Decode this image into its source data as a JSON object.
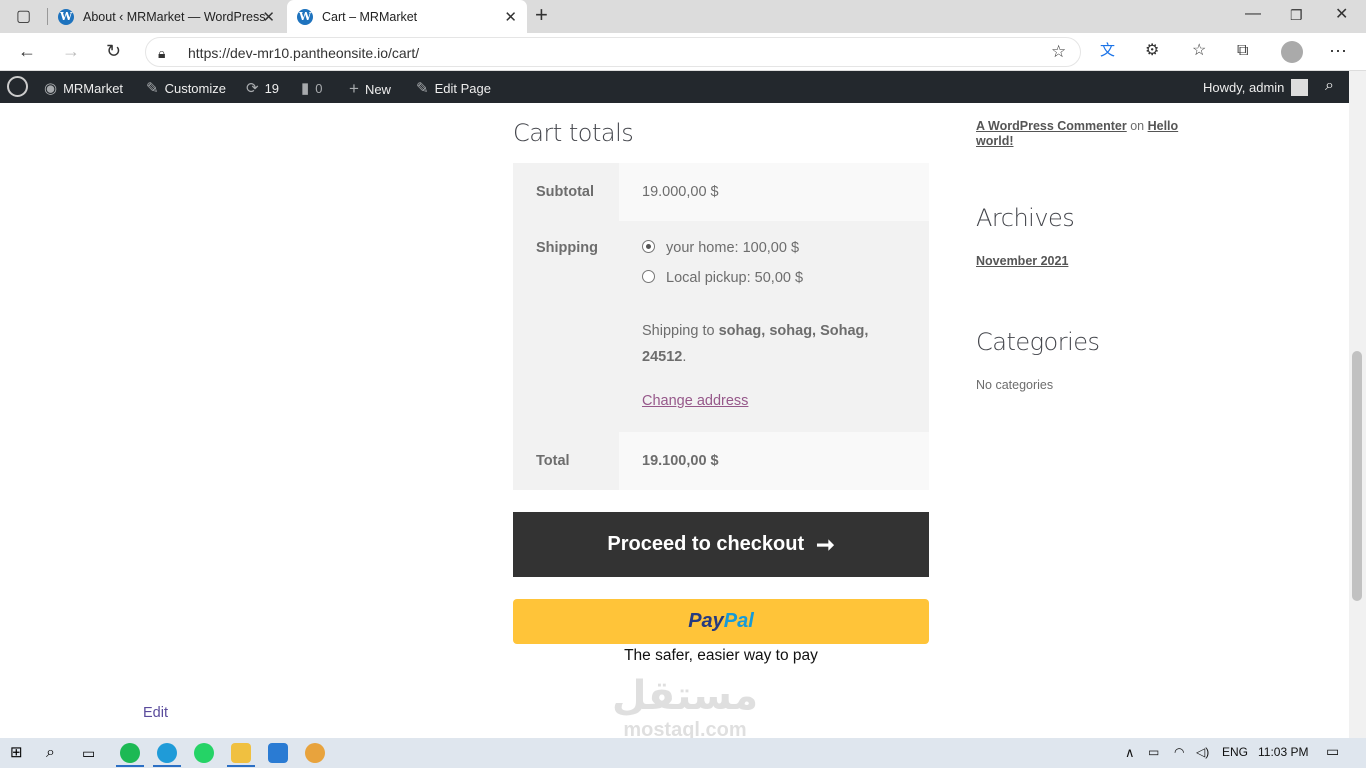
{
  "browser": {
    "tabs": [
      {
        "title": "About ‹ MRMarket — WordPress"
      },
      {
        "title": "Cart – MRMarket"
      }
    ],
    "url": "https://dev-mr10.pantheonsite.io/cart/"
  },
  "adminbar": {
    "site": "MRMarket",
    "customize": "Customize",
    "updates": "19",
    "comments": "0",
    "new": "New",
    "edit_page": "Edit Page",
    "greeting": "Howdy, admin"
  },
  "cart": {
    "title": "Cart totals",
    "subtotal_label": "Subtotal",
    "subtotal_value": "19.000,00 $",
    "shipping_label": "Shipping",
    "shipping_options": [
      {
        "label": "your home: 100,00 $",
        "selected": true
      },
      {
        "label": "Local pickup: 50,00 $",
        "selected": false
      }
    ],
    "shipping_to_prefix": "Shipping to ",
    "shipping_to_address": "sohag, sohag, Sohag, 24512",
    "shipping_to_suffix": ".",
    "change_address": "Change address",
    "total_label": "Total",
    "total_value": "19.100,00 $",
    "checkout_button": "Proceed to checkout",
    "checkout_arrow": "➞",
    "paypal_pay": "Pay",
    "paypal_pal": "Pal",
    "paypal_tagline": "The safer, easier way to pay"
  },
  "footer_edit": "Edit",
  "sidebar": {
    "recent_comment_author": "A WordPress Commenter",
    "recent_comment_on": "on",
    "recent_comment_post": "Hello world!",
    "archives_title": "Archives",
    "archives_item": "November 2021",
    "categories_title": "Categories",
    "categories_empty": "No categories"
  },
  "watermark": {
    "arabic": "مستقل",
    "latin": "mostaql.com"
  },
  "taskbar": {
    "language": "ENG",
    "time": "11:03 PM"
  },
  "colors": {
    "admin_bar": "#23282d",
    "checkout_button": "#333333",
    "paypal_button": "#ffc439",
    "link": "#96588a"
  }
}
